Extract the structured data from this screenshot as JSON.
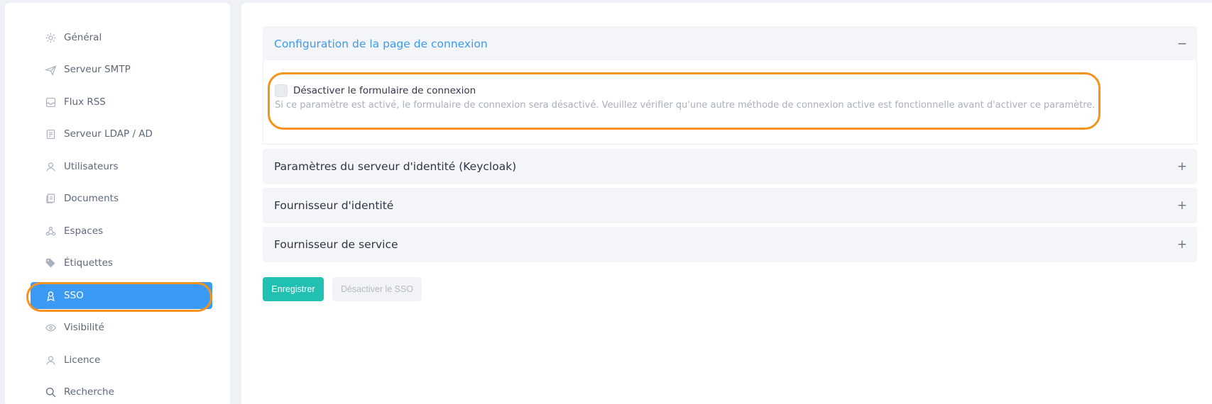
{
  "sidebar": {
    "items": [
      {
        "label": "Général",
        "icon": "gear-icon"
      },
      {
        "label": "Serveur SMTP",
        "icon": "send-icon"
      },
      {
        "label": "Flux RSS",
        "icon": "inbox-icon"
      },
      {
        "label": "Serveur LDAP / AD",
        "icon": "server-icon"
      },
      {
        "label": "Utilisateurs",
        "icon": "user-icon"
      },
      {
        "label": "Documents",
        "icon": "documents-icon"
      },
      {
        "label": "Espaces",
        "icon": "spaces-icon"
      },
      {
        "label": "Étiquettes",
        "icon": "tags-icon"
      },
      {
        "label": "SSO",
        "icon": "badge-icon"
      },
      {
        "label": "Visibilité",
        "icon": "eye-icon"
      },
      {
        "label": "Licence",
        "icon": "license-icon"
      },
      {
        "label": "Recherche",
        "icon": "search-icon"
      }
    ],
    "active_index": 8
  },
  "sections": {
    "login_page": {
      "title": "Configuration de la page de connexion",
      "toggle": "−"
    },
    "identity_server": {
      "title": "Paramètres du serveur d'identité (Keycloak)",
      "toggle": "+"
    },
    "identity_provider": {
      "title": "Fournisseur d'identité",
      "toggle": "+"
    },
    "service_provider": {
      "title": "Fournisseur de service",
      "toggle": "+"
    }
  },
  "login_form": {
    "checkbox_label": "Désactiver le formulaire de connexion",
    "checked": false,
    "help": "Si ce paramètre est activé, le formulaire de connexion sera désactivé. Veuillez vérifier qu'une autre méthode de connexion active est fonctionnelle avant d'activer ce paramètre."
  },
  "buttons": {
    "save": "Enregistrer",
    "disable_sso": "Désactiver le SSO"
  },
  "colors": {
    "accent": "#3a9af4",
    "save": "#22bfb3",
    "highlight": "#f5931c"
  }
}
